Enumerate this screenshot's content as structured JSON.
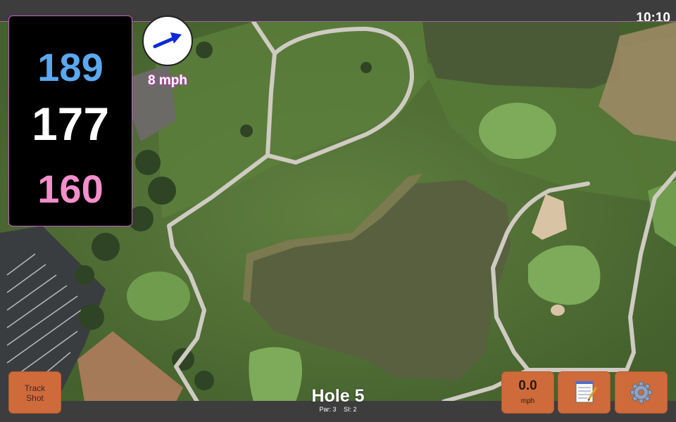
{
  "status_bar": {
    "time": "10:10"
  },
  "distances": {
    "back": "189",
    "center": "177",
    "front": "160"
  },
  "wind": {
    "speed_label": "8 mph",
    "direction_icon": "arrow-icon"
  },
  "hole": {
    "title": "Hole 5",
    "par": "Par: 3",
    "si": "SI: 2"
  },
  "buttons": {
    "track_shot": "Track Shot",
    "speed_value": "0.0",
    "speed_unit": "mph",
    "notes_icon": "notepad-icon",
    "settings_icon": "gear-icon"
  },
  "colors": {
    "back": "#5aa8f0",
    "center": "#ffffff",
    "front": "#f48fcb",
    "button": "#cf6b3a",
    "accent": "#c85ec8"
  }
}
